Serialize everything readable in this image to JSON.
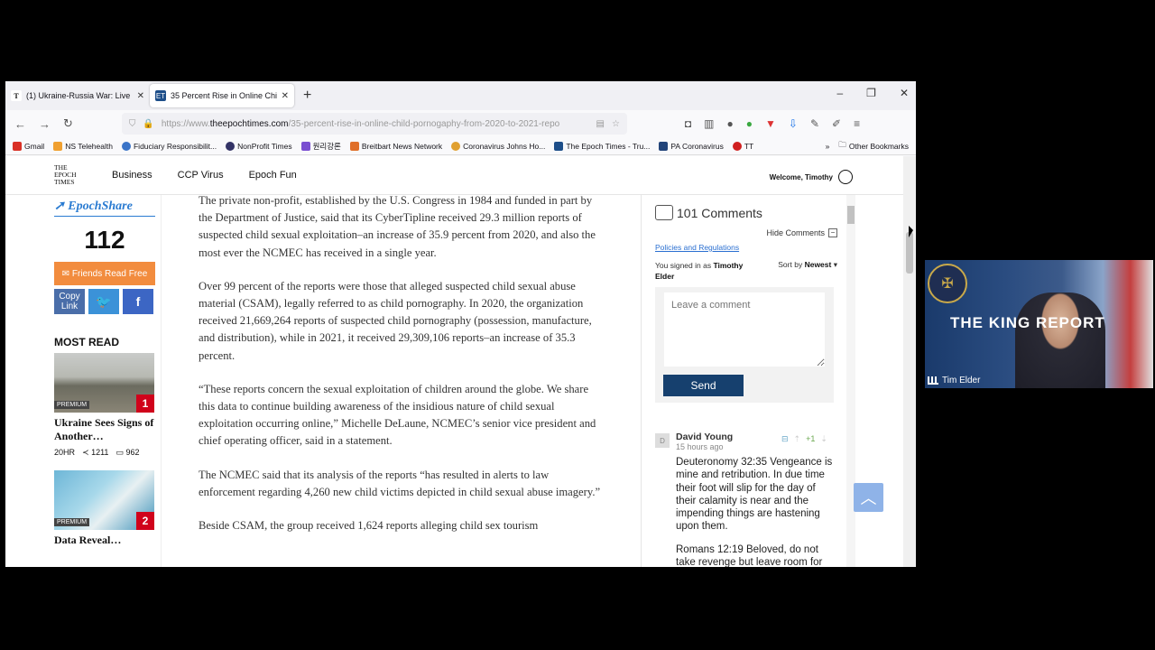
{
  "tabs": [
    {
      "title": "(1) Ukraine-Russia War: Live Ne",
      "favicon": "T",
      "favicon_color": "#111111"
    },
    {
      "title": "35 Percent Rise in Online Child",
      "favicon": "ET",
      "favicon_color": "#1d4e89"
    }
  ],
  "newtab_icon": "+",
  "window": {
    "minimize": "–",
    "restore": "❐",
    "close": "✕"
  },
  "url": {
    "prefix": "https://www.",
    "domain": "theepochtimes.com",
    "path": "/35-percent-rise-in-online-child-pornogaphy-from-2020-to-2021-repo"
  },
  "bookmarks": [
    {
      "label": "Gmail",
      "color": "#d93025"
    },
    {
      "label": "NS Telehealth",
      "color": "#f0a030"
    },
    {
      "label": "Fiduciary Responsibilit...",
      "color": "#3a74c8"
    },
    {
      "label": "NonProfit Times",
      "color": "#333366"
    },
    {
      "label": "원리강론",
      "color": "#7a4fd1"
    },
    {
      "label": "Breitbart News Network",
      "color": "#e0702a"
    },
    {
      "label": "Coronavirus Johns Ho...",
      "color": "#e0a030"
    },
    {
      "label": "The Epoch Times - Tru...",
      "color": "#1d4e89"
    },
    {
      "label": "PA Coronavirus",
      "color": "#22447a"
    },
    {
      "label": "TT",
      "color": "#d02020"
    }
  ],
  "bookmark_overflow": "»",
  "other_bookmarks": "Other Bookmarks",
  "site": {
    "logo_lines": [
      "THE",
      "EPOCH",
      "TIMES"
    ],
    "nav": [
      "Business",
      "CCP Virus",
      "Epoch Fun"
    ],
    "welcome": "Welcome, Timothy"
  },
  "share": {
    "brand": "EpochShare",
    "count": "112",
    "friends_button": "Friends Read Free",
    "copy_link": "Copy Link",
    "twitter": "🐦",
    "facebook": "f"
  },
  "most_read": {
    "heading": "MOST READ",
    "items": [
      {
        "badge": "PREMIUM",
        "rank": "1",
        "title": "Ukraine Sees Signs of Another…",
        "time": "20HR",
        "shares": "1211",
        "comments": "962"
      },
      {
        "badge": "PREMIUM",
        "rank": "2",
        "title": "Data Reveal…"
      }
    ]
  },
  "article": {
    "paragraphs": [
      "The private non-profit, established by the U.S. Congress in 1984 and funded in part by the Department of Justice, said that its CyberTipline received 29.3 million reports of suspected child sexual exploitation–an increase of 35.9 percent from 2020, and also the most ever the NCMEC has received in a single year.",
      "Over 99 percent of the reports were those that alleged suspected child sexual abuse material (CSAM), legally referred to as child pornography. In 2020, the organization received 21,669,264 reports of suspected child pornography (possession, manufacture, and distribution), while in 2021, it received 29,309,106 reports–an increase of 35.3 percent.",
      "“These reports concern the sexual exploitation of children around the globe. We share this data to continue building awareness of the insidious nature of child sexual exploitation occurring online,” Michelle DeLaune, NCMEC’s senior vice president and chief operating officer, said in a statement.",
      "The NCMEC said that its analysis of the reports “has resulted in alerts to law enforcement regarding 4,260 new child victims depicted in child sexual abuse imagery.”",
      "Beside CSAM, the group received 1,624 reports alleging child sex tourism"
    ]
  },
  "comments": {
    "count_label": "101 Comments",
    "hide_label": "Hide Comments",
    "policies_link": "Policies and Regulations",
    "signed_in_prefix": "You signed in as",
    "signed_in_user": "Timothy Elder",
    "sort_prefix": "Sort by",
    "sort_value": "Newest",
    "input_placeholder": "Leave a comment",
    "send_label": "Send",
    "items": [
      {
        "avatar": "D",
        "author": "David Young",
        "time": "15 hours ago",
        "score": "+1",
        "paragraphs": [
          "Deuteronomy 32:35 Vengeance is mine and retribution. In due time their foot will slip for the day of their calamity is near and the impending things are hastening upon them.",
          "Romans 12:19 Beloved, do not take revenge but leave room for"
        ]
      }
    ]
  },
  "webcam": {
    "banner": "THE KING REPORT",
    "participant": "Tim Elder"
  }
}
